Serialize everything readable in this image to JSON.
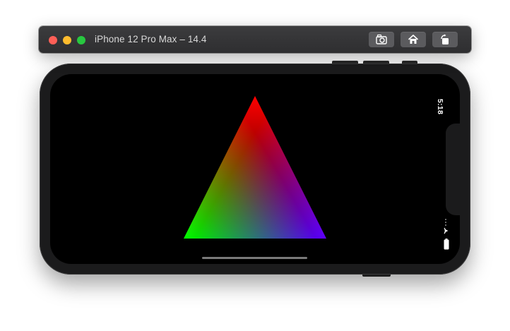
{
  "window": {
    "title": "iPhone 12 Pro Max – 14.4",
    "toolbar_buttons": [
      {
        "name": "screenshot",
        "icon": "camera-icon"
      },
      {
        "name": "home",
        "icon": "home-icon"
      },
      {
        "name": "rotate",
        "icon": "rotate-icon"
      }
    ]
  },
  "status_bar": {
    "time": "5:18",
    "icons": [
      "cellular-dots-icon",
      "wifi-icon",
      "battery-icon"
    ]
  },
  "content": {
    "shape": "triangle",
    "vertex_colors": {
      "top": "#ff0000",
      "bottom_left": "#00ff00",
      "bottom_right": "#5e00ff"
    }
  },
  "colors": {
    "traffic_close": "#ff5f57",
    "traffic_minimize": "#febc2e",
    "traffic_zoom": "#28c840",
    "screen_background": "#000000",
    "phone_bezel": "#1b1b1c"
  }
}
